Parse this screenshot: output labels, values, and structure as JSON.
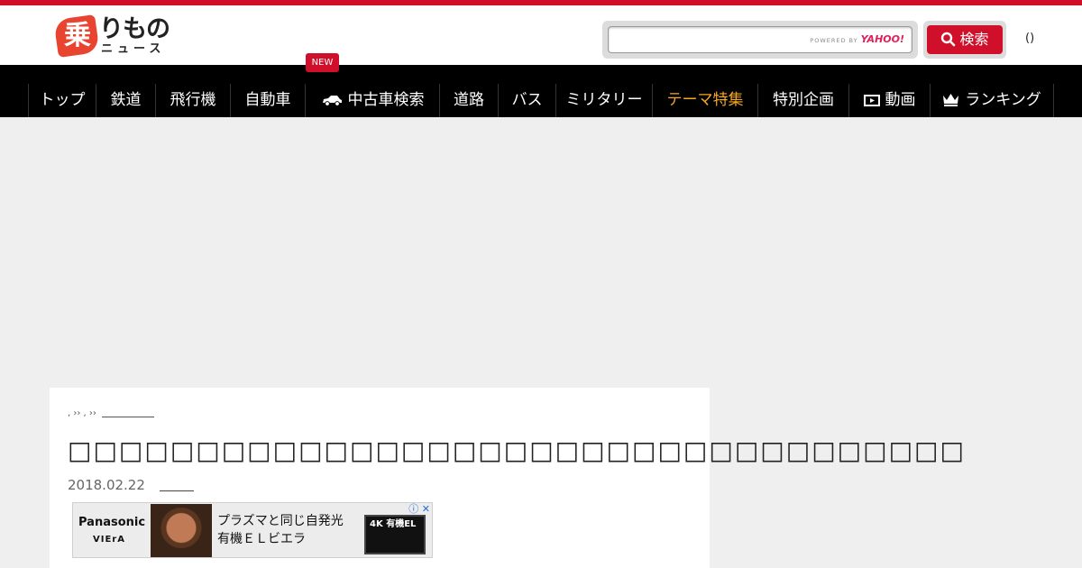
{
  "header": {
    "logo_kanji": "乗",
    "logo_main": "りもの",
    "logo_sub": "ニュース",
    "search": {
      "placeholder": "",
      "powered_by": "POWERED BY",
      "provider": "YAHOO!"
    },
    "search_button_label": "検索",
    "user_parens": "()"
  },
  "nav": {
    "new_badge": "NEW",
    "items": [
      {
        "label": "トップ"
      },
      {
        "label": "鉄道"
      },
      {
        "label": "飛行機"
      },
      {
        "label": "自動車"
      },
      {
        "label": "中古車検索",
        "icon": "car-icon"
      },
      {
        "label": "道路"
      },
      {
        "label": "バス"
      },
      {
        "label": "ミリタリー"
      },
      {
        "label": "テーマ特集",
        "color": "#f5a623"
      },
      {
        "label": "特別企画"
      },
      {
        "label": "動画",
        "icon": "video-icon"
      },
      {
        "label": "ランキング",
        "icon": "crown-icon"
      }
    ]
  },
  "article": {
    "breadcrumb_text": ", ›› , ››",
    "title": "□□□□□□□□□□□□□□□□□□□□□□□□□□□□□□□□□□□",
    "date": "2018.02.22"
  },
  "banner": {
    "brand": "Panasonic",
    "sub": "VIErA",
    "copy_line1": "プラズマと同じ自発光",
    "copy_line2": "有機ＥＬビエラ",
    "tv_label": "4K 有機EL",
    "ad_icons": "ⓘ ✕"
  },
  "colors": {
    "brand_red": "#d0102a",
    "nav_bg": "#000000",
    "accent": "#f5a623",
    "page_bg": "#efefef"
  }
}
